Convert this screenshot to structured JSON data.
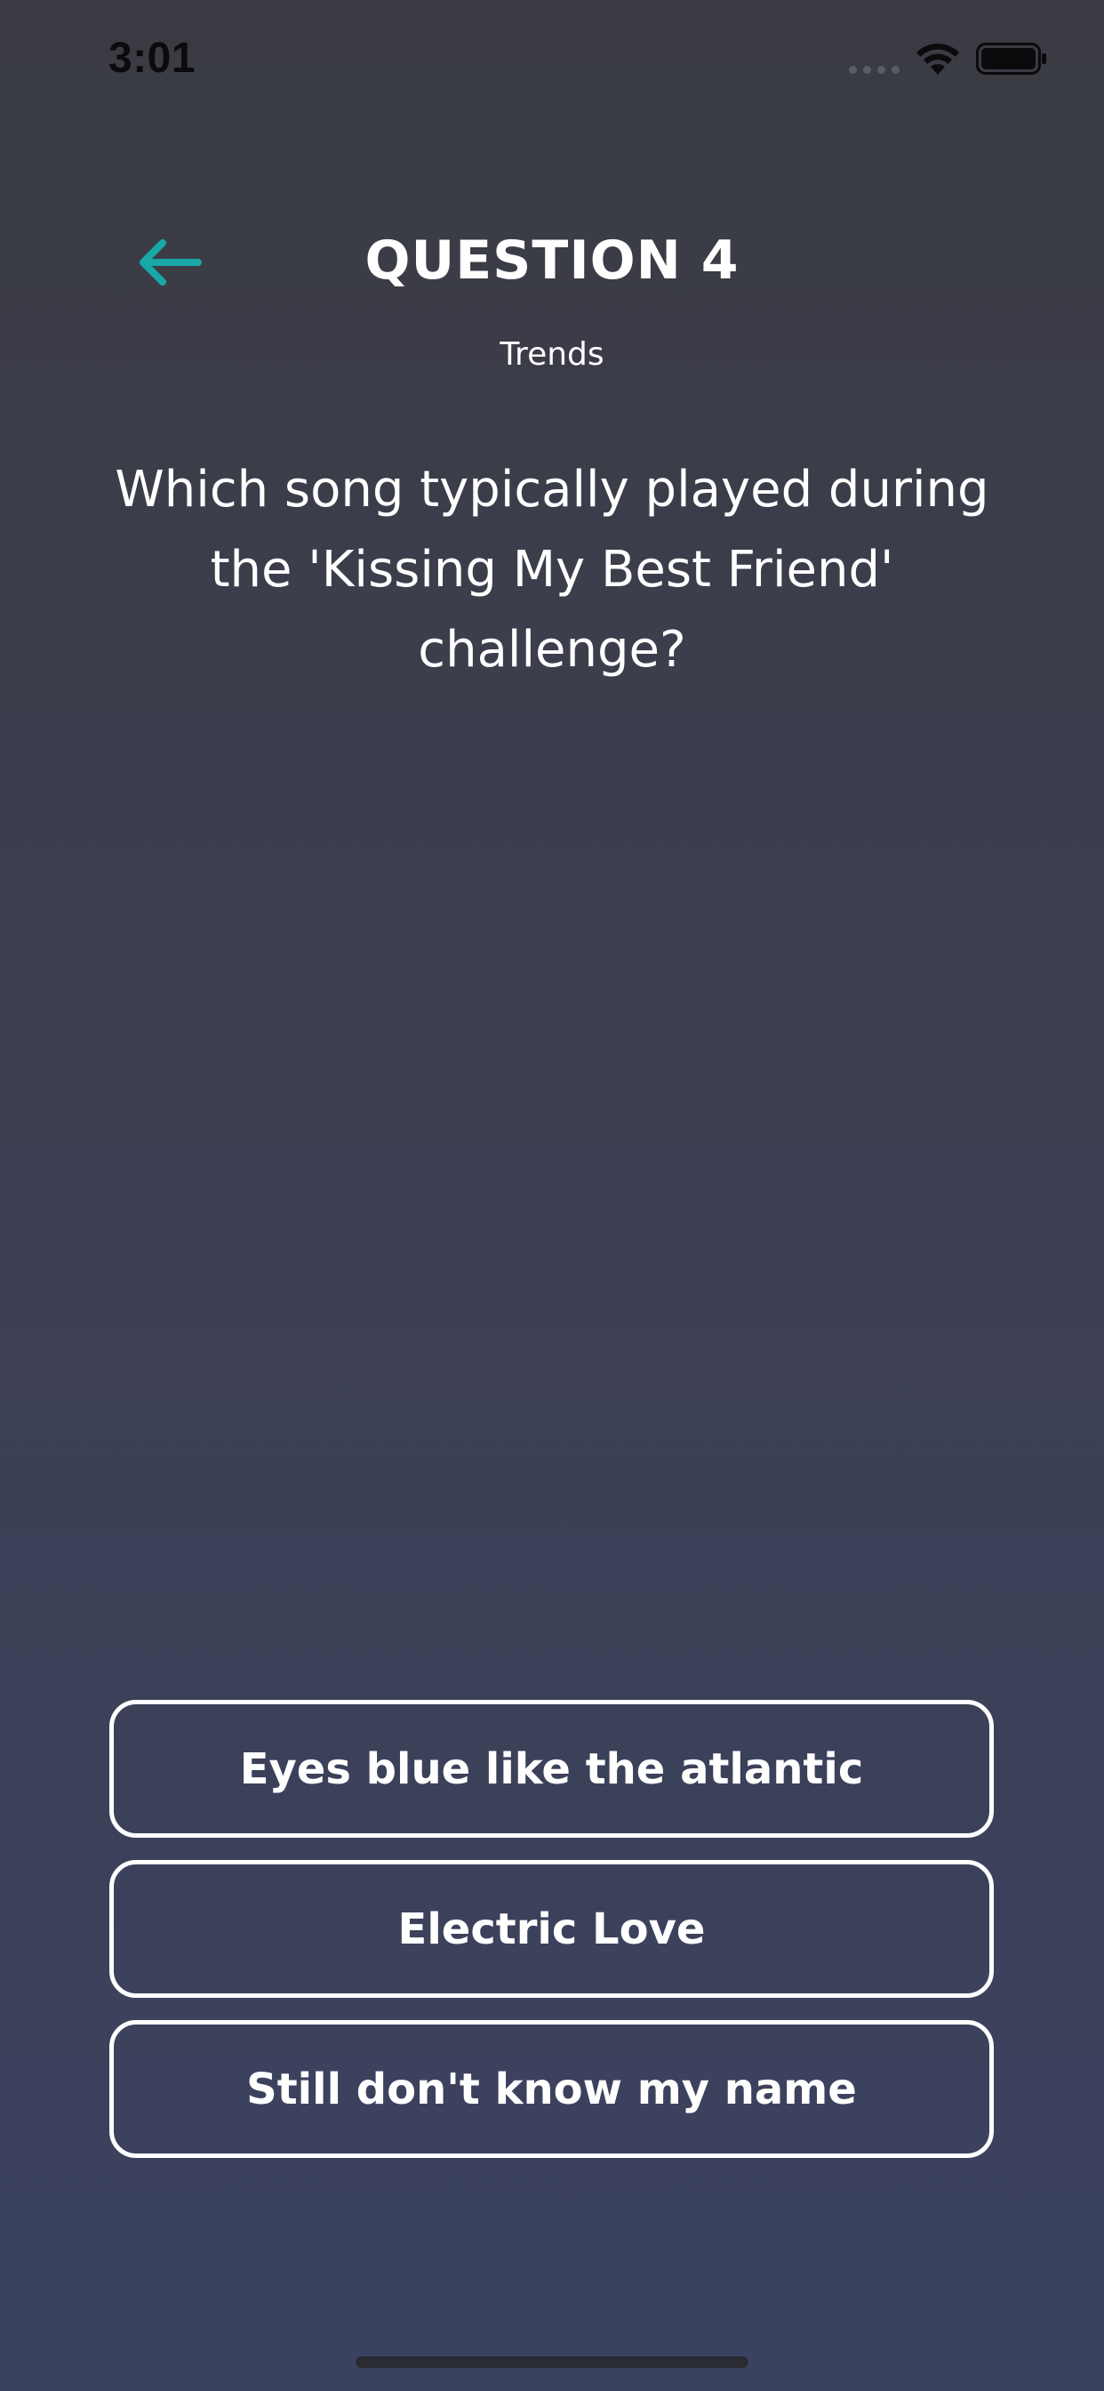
{
  "status_bar": {
    "time": "3:01"
  },
  "header": {
    "title": "QUESTION 4",
    "category": "Trends"
  },
  "question": {
    "text": "Which song typically played during the 'Kissing My Best Friend' challenge?"
  },
  "answers": [
    {
      "label": "Eyes blue like the atlantic"
    },
    {
      "label": "Electric Love"
    },
    {
      "label": "Still don't know my name"
    }
  ],
  "colors": {
    "accent": "#18a8a8",
    "background_top": "#3a3b42",
    "background_bottom": "#3b4260",
    "text": "#ffffff"
  },
  "icons": {
    "back": "arrow-left-icon",
    "wifi": "wifi-icon",
    "battery": "battery-icon",
    "signal": "cellular-signal-icon"
  }
}
